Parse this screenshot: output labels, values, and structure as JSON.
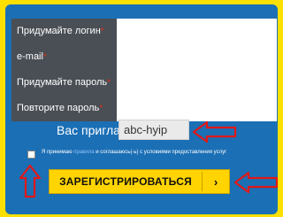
{
  "form": {
    "fields": [
      {
        "label": "Придумайте логин",
        "required": "*"
      },
      {
        "label": "e-mail",
        "required": "*"
      },
      {
        "label": "Придумайте пароль",
        "required": "*"
      },
      {
        "label": "Повторите пароль",
        "required": "*"
      }
    ],
    "referral": {
      "label": "Вас пригласил",
      "value": "abc-hyip"
    },
    "terms": {
      "prefix": "Я принимаю",
      "link": "правила",
      "suffix": "и соглашаюсь(-ь) с условиями предоставления услуг"
    },
    "submit_label": "ЗАРЕГИСТРИРОВАТЬСЯ",
    "submit_arrow": "›"
  },
  "colors": {
    "background": "#fde000",
    "panel": "#1b6fb5",
    "label_bg": "#4a4f56",
    "annotation_arrow": "#e01818"
  },
  "annotations": [
    "arrow-left-icon",
    "arrow-up-icon",
    "arrow-left-icon"
  ]
}
